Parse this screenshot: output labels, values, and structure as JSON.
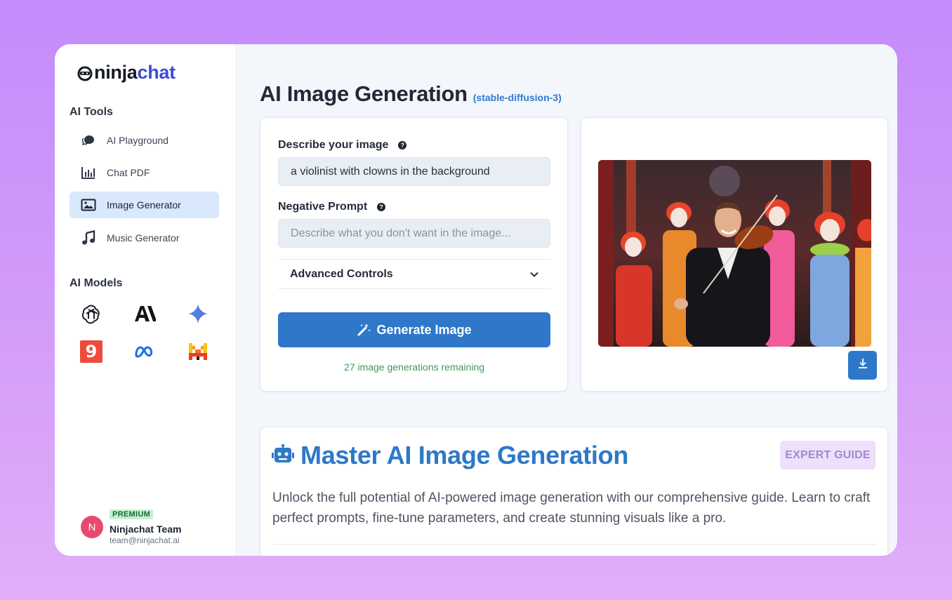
{
  "brand": {
    "logo_prefix": "ninja",
    "logo_suffix": "chat"
  },
  "sidebar": {
    "tools_label": "AI Tools",
    "items": [
      {
        "label": "AI Playground",
        "icon": "chat-bubble-icon",
        "active": false
      },
      {
        "label": "Chat PDF",
        "icon": "bar-chart-icon",
        "active": false
      },
      {
        "label": "Image Generator",
        "icon": "image-icon",
        "active": true
      },
      {
        "label": "Music Generator",
        "icon": "music-note-icon",
        "active": false
      }
    ],
    "models_label": "AI Models",
    "models": [
      {
        "name": "openai-icon"
      },
      {
        "name": "anthropic-icon",
        "glyph": "A\\"
      },
      {
        "name": "gemini-icon"
      },
      {
        "name": "nine-icon",
        "glyph": "9"
      },
      {
        "name": "meta-icon",
        "glyph": "∞"
      },
      {
        "name": "mistral-icon",
        "glyph": "M"
      }
    ],
    "user": {
      "badge": "PREMIUM",
      "initial": "N",
      "name": "Ninjachat Team",
      "email": "team@ninjachat.ai"
    }
  },
  "main": {
    "title": "AI Image Generation",
    "model_tag": "(stable-diffusion-3)",
    "form": {
      "prompt_label": "Describe your image",
      "prompt_value": "a violinist with clowns in the background",
      "negative_label": "Negative Prompt",
      "negative_placeholder": "Describe what you don't want in the image...",
      "advanced_label": "Advanced Controls",
      "generate_label": "Generate Image",
      "remaining_text": "27 image generations remaining"
    },
    "guide": {
      "title": "Master AI Image Generation",
      "badge": "EXPERT GUIDE",
      "description": "Unlock the full potential of AI-powered image generation with our comprehensive guide. Learn to craft perfect prompts, fine-tune parameters, and create stunning visuals like a pro."
    }
  },
  "colors": {
    "accent": "#2f78c9",
    "brand_blue": "#3d4bd8",
    "active_nav": "#d9e8fb",
    "success_text": "#3c9a5a",
    "premium_bg": "#c5f0cf",
    "avatar": "#e84a6f"
  }
}
